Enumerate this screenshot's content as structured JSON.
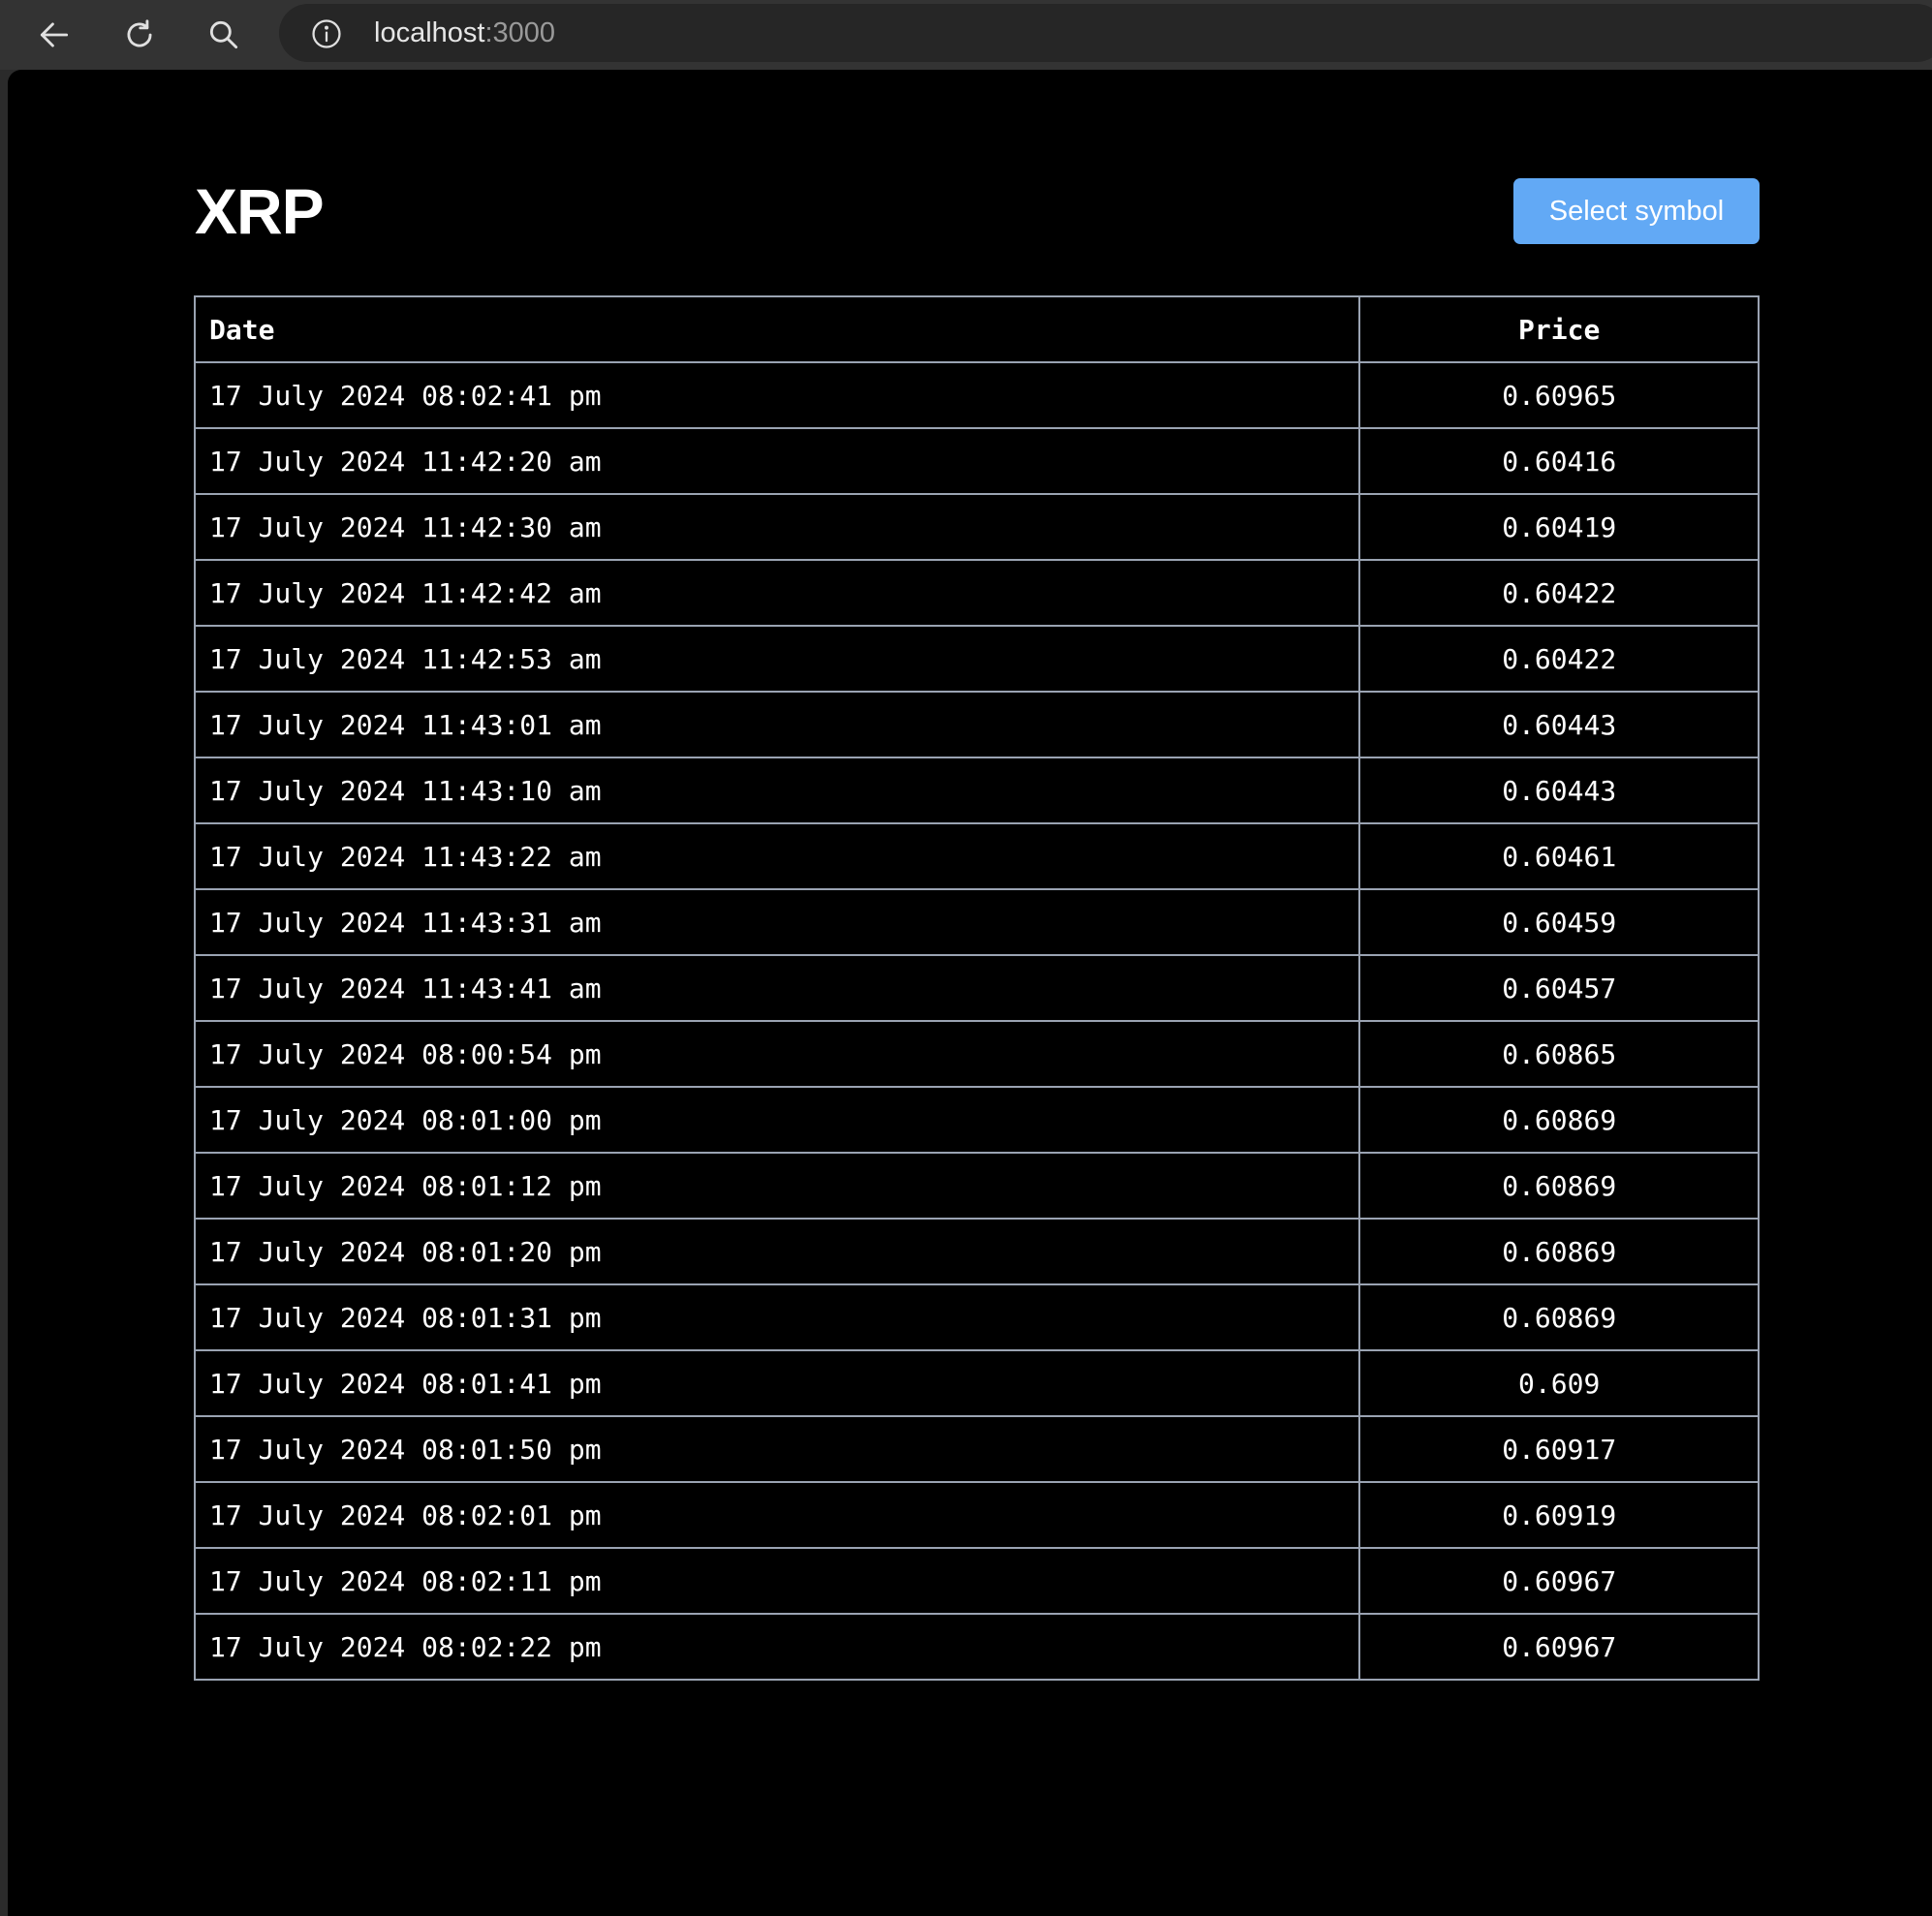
{
  "browser": {
    "url_host": "localhost",
    "url_port": ":3000"
  },
  "page": {
    "title": "XRP",
    "select_button_label": "Select symbol"
  },
  "table": {
    "headers": [
      "Date",
      "Price"
    ],
    "rows": [
      [
        "17 July 2024 08:02:41 pm",
        "0.60965"
      ],
      [
        "17 July 2024 11:42:20 am",
        "0.60416"
      ],
      [
        "17 July 2024 11:42:30 am",
        "0.60419"
      ],
      [
        "17 July 2024 11:42:42 am",
        "0.60422"
      ],
      [
        "17 July 2024 11:42:53 am",
        "0.60422"
      ],
      [
        "17 July 2024 11:43:01 am",
        "0.60443"
      ],
      [
        "17 July 2024 11:43:10 am",
        "0.60443"
      ],
      [
        "17 July 2024 11:43:22 am",
        "0.60461"
      ],
      [
        "17 July 2024 11:43:31 am",
        "0.60459"
      ],
      [
        "17 July 2024 11:43:41 am",
        "0.60457"
      ],
      [
        "17 July 2024 08:00:54 pm",
        "0.60865"
      ],
      [
        "17 July 2024 08:01:00 pm",
        "0.60869"
      ],
      [
        "17 July 2024 08:01:12 pm",
        "0.60869"
      ],
      [
        "17 July 2024 08:01:20 pm",
        "0.60869"
      ],
      [
        "17 July 2024 08:01:31 pm",
        "0.60869"
      ],
      [
        "17 July 2024 08:01:41 pm",
        "0.609"
      ],
      [
        "17 July 2024 08:01:50 pm",
        "0.60917"
      ],
      [
        "17 July 2024 08:02:01 pm",
        "0.60919"
      ],
      [
        "17 July 2024 08:02:11 pm",
        "0.60967"
      ],
      [
        "17 July 2024 08:02:22 pm",
        "0.60967"
      ]
    ]
  },
  "icons": {
    "back": "back-arrow-icon",
    "reload": "reload-icon",
    "search": "search-icon",
    "info": "info-icon"
  },
  "colors": {
    "page_background": "#000000",
    "button_accent": "#62a9f5",
    "table_border": "#9aa3b2",
    "toolbar": "#333333"
  }
}
